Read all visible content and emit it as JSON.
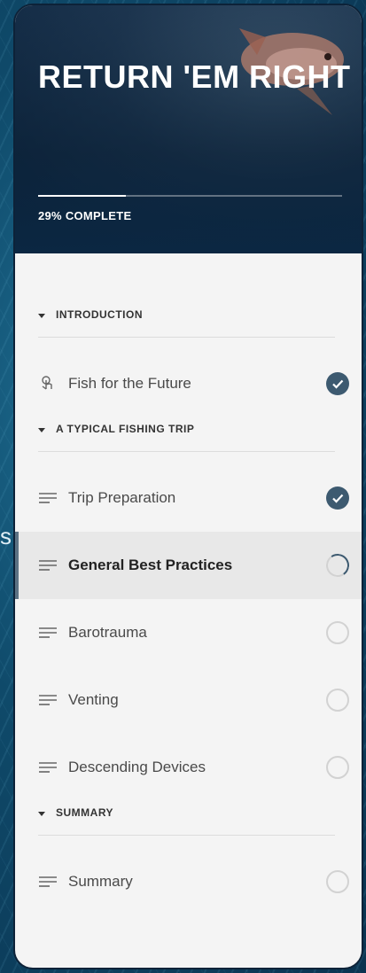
{
  "background_fragment": "s",
  "course": {
    "title": "RETURN 'EM RIGHT",
    "progress_percent": 29,
    "progress_label": "29% COMPLETE"
  },
  "sections": [
    {
      "label": "INTRODUCTION",
      "items": [
        {
          "title": "Fish for the Future",
          "icon": "hand-pointer-icon",
          "status": "complete"
        }
      ]
    },
    {
      "label": "A TYPICAL FISHING TRIP",
      "items": [
        {
          "title": "Trip Preparation",
          "icon": "text-lines-icon",
          "status": "complete"
        },
        {
          "title": "General Best Practices",
          "icon": "text-lines-icon",
          "status": "in-progress"
        },
        {
          "title": "Barotrauma",
          "icon": "text-lines-icon",
          "status": "not-started"
        },
        {
          "title": "Venting",
          "icon": "text-lines-icon",
          "status": "not-started"
        },
        {
          "title": "Descending Devices",
          "icon": "text-lines-icon",
          "status": "not-started"
        }
      ]
    },
    {
      "label": "SUMMARY",
      "items": [
        {
          "title": "Summary",
          "icon": "text-lines-icon",
          "status": "not-started"
        }
      ]
    }
  ],
  "colors": {
    "accent": "#3d5a70",
    "hero_bg": "#0b2742",
    "panel_bg": "#f4f4f4"
  }
}
